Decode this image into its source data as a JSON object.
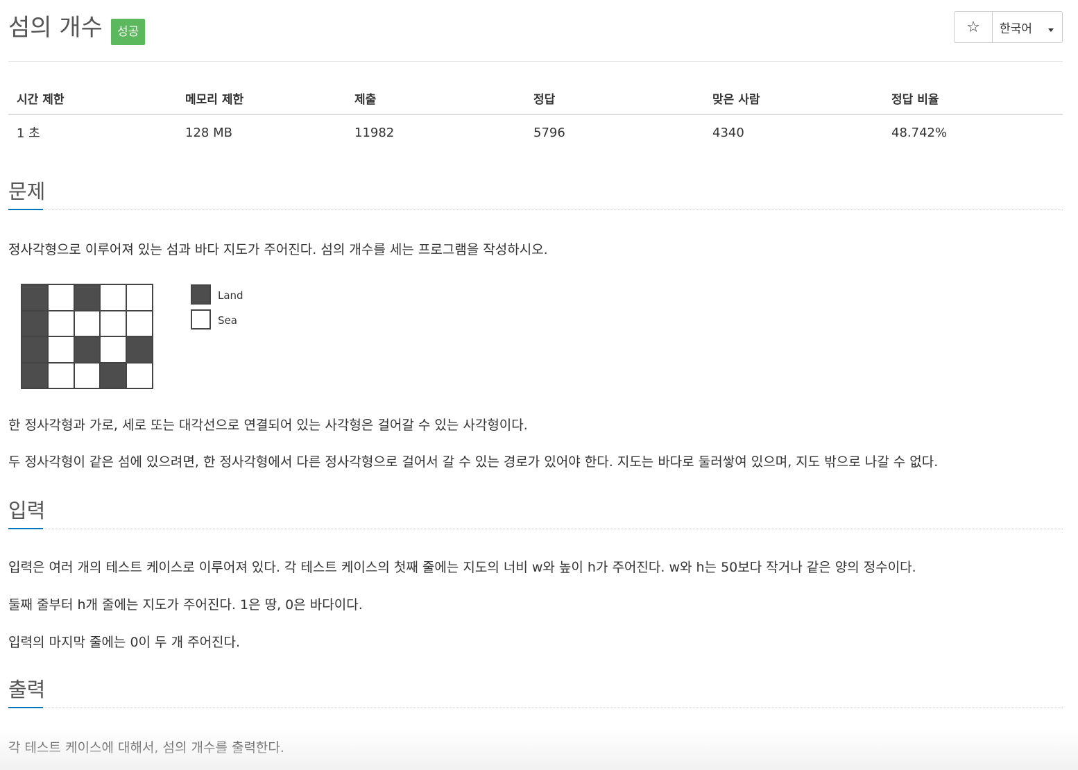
{
  "header": {
    "title": "섬의 개수",
    "status_badge": "성공",
    "star_icon": "☆",
    "language": "한국어"
  },
  "stats": {
    "headers": [
      "시간 제한",
      "메모리 제한",
      "제출",
      "정답",
      "맞은 사람",
      "정답 비율"
    ],
    "values": [
      "1 초",
      "128 MB",
      "11982",
      "5796",
      "4340",
      "48.742%"
    ]
  },
  "problem": {
    "heading": "문제",
    "intro": "정사각형으로 이루어져 있는 섬과 바다 지도가 주어진다. 섬의 개수를 세는 프로그램을 작성하시오.",
    "figure": {
      "grid": [
        [
          1,
          0,
          1,
          0,
          0
        ],
        [
          1,
          0,
          0,
          0,
          0
        ],
        [
          1,
          0,
          1,
          0,
          1
        ],
        [
          1,
          0,
          0,
          1,
          0
        ]
      ],
      "legend_land": "Land",
      "legend_sea": "Sea"
    },
    "para1": "한 정사각형과 가로, 세로 또는 대각선으로 연결되어 있는 사각형은 걸어갈 수 있는 사각형이다.",
    "para2": "두 정사각형이 같은 섬에 있으려면, 한 정사각형에서 다른 정사각형으로 걸어서 갈 수 있는 경로가 있어야 한다. 지도는 바다로 둘러쌓여 있으며, 지도 밖으로 나갈 수 없다."
  },
  "input": {
    "heading": "입력",
    "para1": "입력은 여러 개의 테스트 케이스로 이루어져 있다. 각 테스트 케이스의 첫째 줄에는 지도의 너비 w와 높이 h가 주어진다. w와 h는 50보다 작거나 같은 양의 정수이다.",
    "para2": "둘째 줄부터 h개 줄에는 지도가 주어진다. 1은 땅, 0은 바다이다.",
    "para3": "입력의 마지막 줄에는 0이 두 개 주어진다."
  },
  "output": {
    "heading": "출력",
    "para1": "각 테스트 케이스에 대해서, 섬의 개수를 출력한다."
  }
}
